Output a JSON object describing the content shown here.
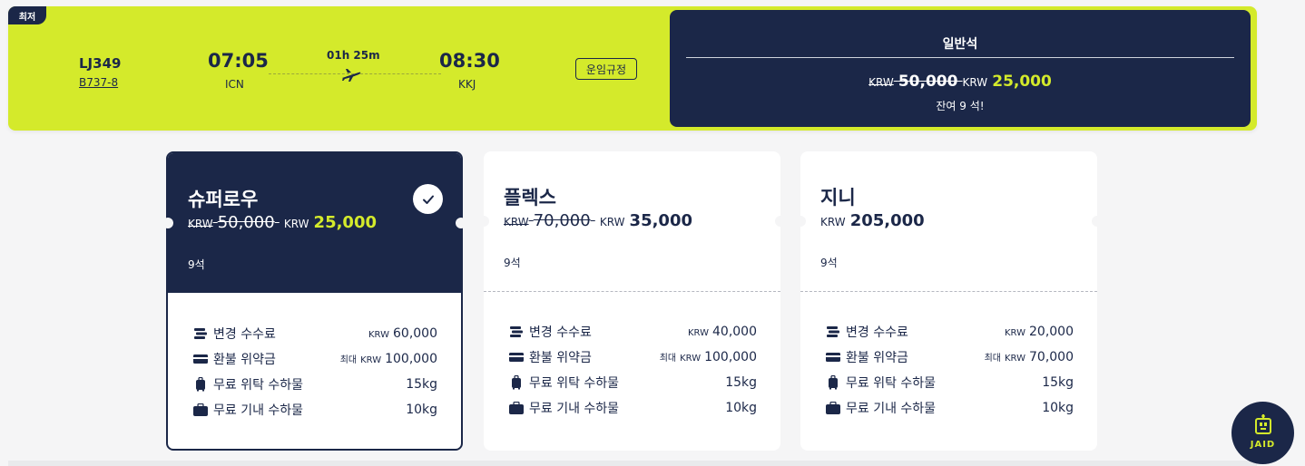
{
  "flight": {
    "badge": "최저",
    "number": "LJ349",
    "aircraft": "B737-8",
    "departure_time": "07:05",
    "departure_code": "ICN",
    "duration": "01h 25m",
    "arrival_time": "08:30",
    "arrival_code": "KKJ",
    "fare_rules_label": "운임규정"
  },
  "economy": {
    "title": "일반석",
    "currency": "KRW",
    "original_price": "50,000",
    "price": "25,000",
    "seats_left": "잔여 9 석!"
  },
  "row_labels": {
    "change_fee": "변경 수수료",
    "refund_fee": "환불 위약금",
    "checked_bag": "무료 위탁 수하물",
    "carry_on": "무료 기내 수하물",
    "refund_max_prefix": "최대",
    "currency": "KRW"
  },
  "fares": [
    {
      "name": "슈퍼로우",
      "currency": "KRW",
      "original_price": "50,000",
      "price": "25,000",
      "seats": "9석",
      "change_fee": "60,000",
      "refund_fee": "100,000",
      "checked_bag": "15kg",
      "carry_on": "10kg",
      "selected": true
    },
    {
      "name": "플렉스",
      "currency": "KRW",
      "original_price": "70,000",
      "price": "35,000",
      "seats": "9석",
      "change_fee": "40,000",
      "refund_fee": "100,000",
      "checked_bag": "15kg",
      "carry_on": "10kg",
      "selected": false
    },
    {
      "name": "지니",
      "currency": "KRW",
      "original_price": "",
      "price": "205,000",
      "seats": "9석",
      "change_fee": "20,000",
      "refund_fee": "70,000",
      "checked_bag": "15kg",
      "carry_on": "10kg",
      "selected": false
    }
  ],
  "assistant": {
    "label": "JAID"
  },
  "colors": {
    "navy": "#1b2748",
    "lime": "#d4ea2b"
  },
  "icons": [
    "plane-icon",
    "check-icon",
    "change-fee-icon",
    "refund-card-icon",
    "checked-bag-icon",
    "carry-on-icon",
    "robot-icon"
  ]
}
